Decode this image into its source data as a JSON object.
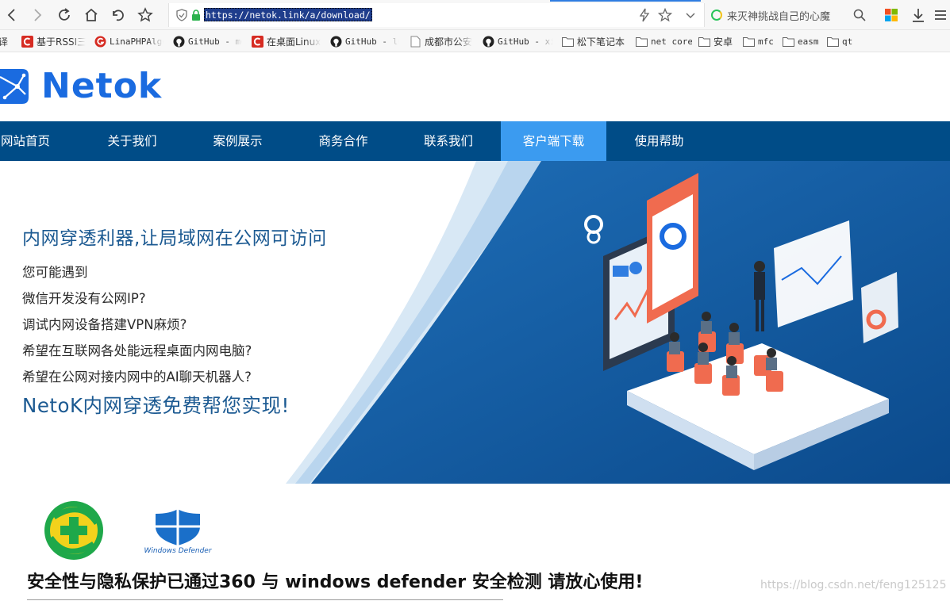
{
  "browser": {
    "url": "https://netok.link/a/download/",
    "search_text": "来灭神挑战自己的心魔",
    "accent_color": "#2f7de1"
  },
  "bookmarks": [
    {
      "label": "翻译",
      "icon": "folder-icon"
    },
    {
      "label": "基于RSSI三",
      "icon": "csdn-icon"
    },
    {
      "label": "LinaPHPAlgo",
      "icon": "g-icon"
    },
    {
      "label": "GitHub - mo",
      "icon": "github-icon"
    },
    {
      "label": "在桌面Linux",
      "icon": "csdn-icon"
    },
    {
      "label": "GitHub - lu",
      "icon": "github-icon"
    },
    {
      "label": "成都市公安",
      "icon": "page-icon"
    },
    {
      "label": "GitHub - xi",
      "icon": "github-icon"
    },
    {
      "label": "松下笔记本",
      "icon": "folder-icon"
    },
    {
      "label": "net core",
      "icon": "folder-icon"
    },
    {
      "label": "安卓",
      "icon": "folder-icon"
    },
    {
      "label": "mfc",
      "icon": "folder-icon"
    },
    {
      "label": "easm",
      "icon": "folder-icon"
    },
    {
      "label": "qt",
      "icon": "folder-icon"
    }
  ],
  "site": {
    "logo_text": "Netok",
    "brand_color": "#1a6be0",
    "nav_color": "#004c87",
    "nav_active_color": "#3b9bf0",
    "nav": [
      {
        "label": "网站首页",
        "active": false
      },
      {
        "label": "关于我们",
        "active": false
      },
      {
        "label": "案例展示",
        "active": false
      },
      {
        "label": "商务合作",
        "active": false
      },
      {
        "label": "联系我们",
        "active": false
      },
      {
        "label": "客户端下载",
        "active": true
      },
      {
        "label": "使用帮助",
        "active": false
      }
    ]
  },
  "banner": {
    "title": "内网穿透利器,让局域网在公网可访问",
    "lines": [
      "您可能遇到",
      "微信开发没有公网IP?",
      "调试内网设备搭建VPN麻烦?",
      "希望在互联网各处能远程桌面内网电脑?",
      "希望在公网对接内网中的AI聊天机器人?"
    ],
    "cta": "NetoK内网穿透免费帮您实现!"
  },
  "security": {
    "defender_label": "Windows Defender",
    "text": "安全性与隐私保护已通过360 与 windows defender 安全检测 请放心使用!",
    "watermark": "https://blog.csdn.net/feng125125"
  }
}
